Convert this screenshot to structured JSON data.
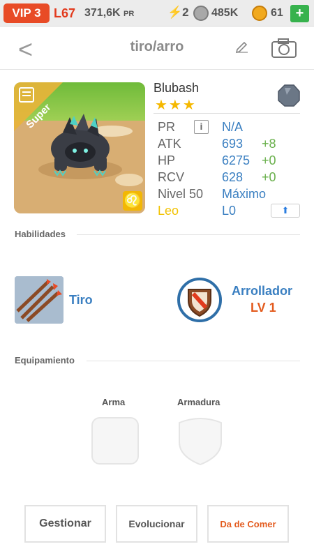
{
  "topbar": {
    "vip": "VIP 3",
    "level": "L67",
    "power_value": "371,6K",
    "power_unit": "PR",
    "energy": "2",
    "food": "485K",
    "coins": "61",
    "add_label": "+"
  },
  "header": {
    "title": "tiro/arro",
    "back_label": "<"
  },
  "monster": {
    "name": "Blubash",
    "stars": "★★★",
    "rarity": "Super",
    "zodiac_symbol": "♌",
    "stats": {
      "pr_label": "PR",
      "pr_info": "i",
      "pr_value": "N/A",
      "atk_label": "ATK",
      "atk_value": "693",
      "atk_bonus": "+8",
      "hp_label": "HP",
      "hp_value": "6275",
      "hp_bonus": "+0",
      "rcv_label": "RCV",
      "rcv_value": "628",
      "rcv_bonus": "+0",
      "level_label": "Nivel 50",
      "level_value": "Máximo",
      "zodiac_label": "Leo",
      "zodiac_value": "L0",
      "upgrade_icon": "⬆"
    }
  },
  "skills": {
    "section_title": "Habilidades",
    "skill_name": "Tiro",
    "ability_name": "Arrollador",
    "ability_level": "LV 1"
  },
  "equipment": {
    "section_title": "Equipamiento",
    "weapon_label": "Arma",
    "armor_label": "Armadura"
  },
  "actions": {
    "manage": "Gestionar",
    "evolve": "Evolucionar",
    "feed": "Da de Comer"
  },
  "colors": {
    "accent_blue": "#3a7fc1",
    "accent_orange": "#e35b1e",
    "vip_red": "#e84b26",
    "bonus_green": "#6ab04c",
    "leo_yellow": "#f2c200"
  }
}
